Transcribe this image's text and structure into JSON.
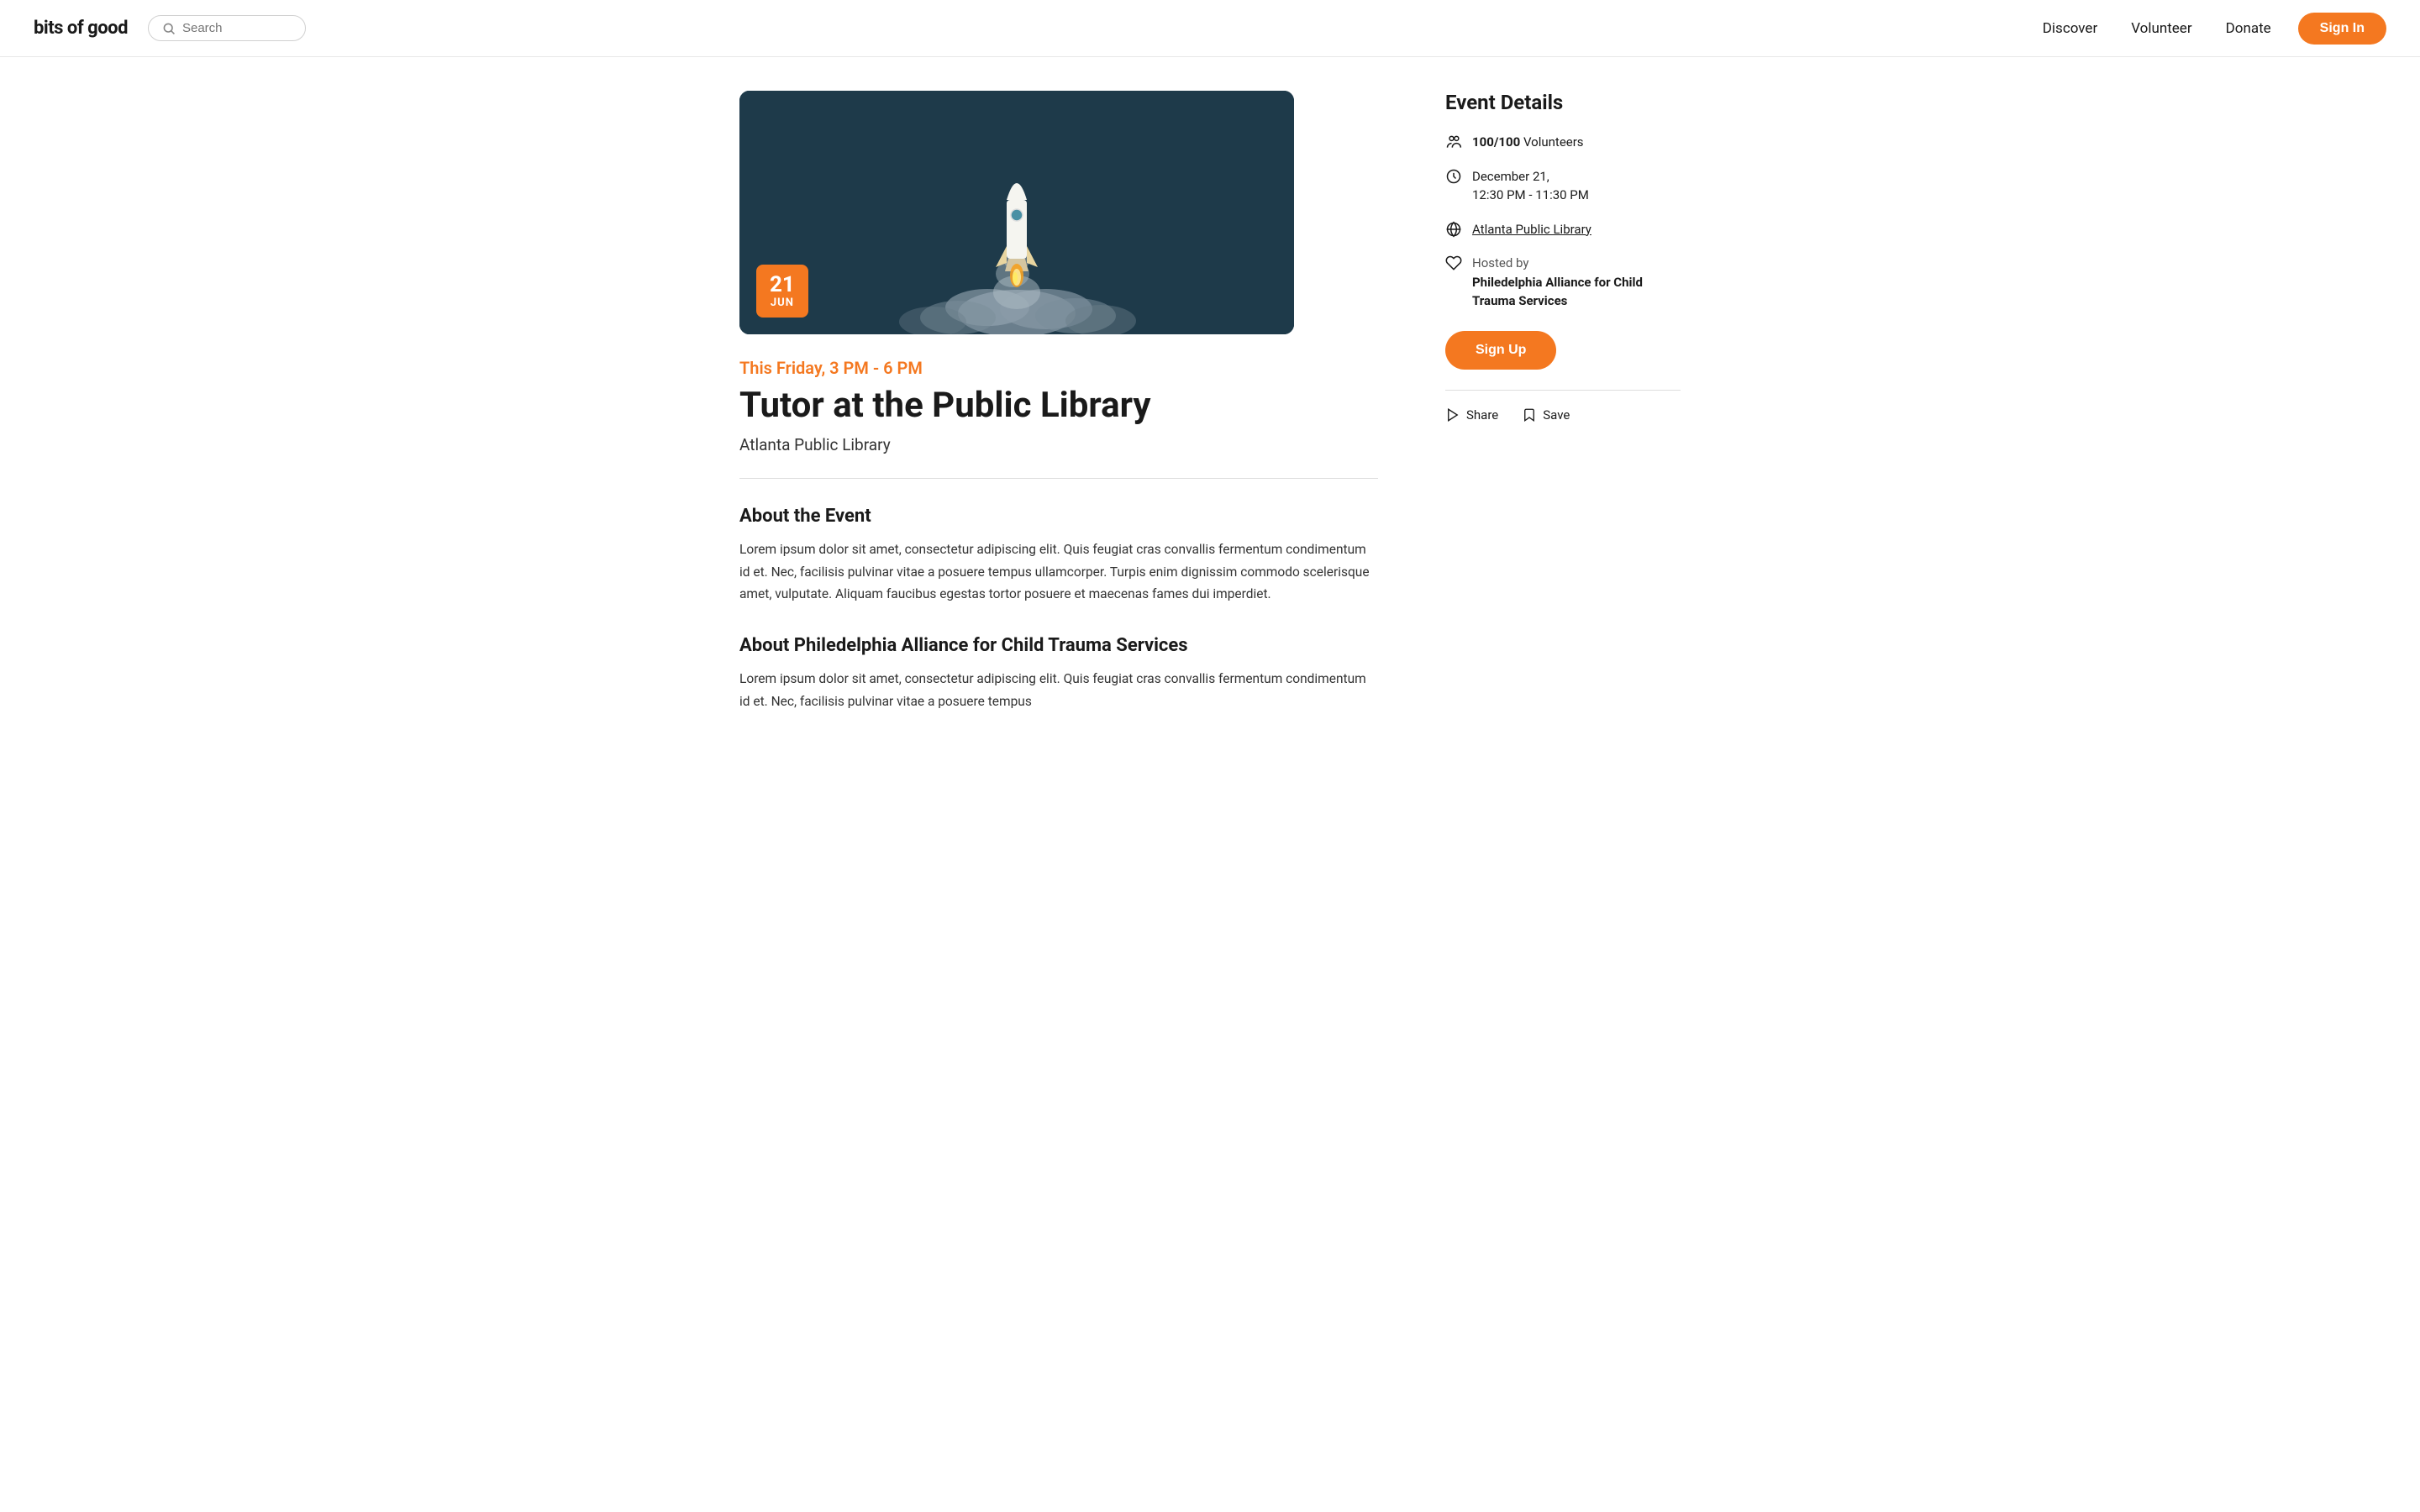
{
  "nav": {
    "logo": "bits of good",
    "search_placeholder": "Search",
    "links": [
      {
        "label": "Discover",
        "id": "discover"
      },
      {
        "label": "Volunteer",
        "id": "volunteer"
      },
      {
        "label": "Donate",
        "id": "donate"
      }
    ],
    "signin_label": "Sign In"
  },
  "hero": {
    "date_day": "21",
    "date_month": "JUN"
  },
  "event": {
    "time": "This Friday, 3 PM - 6 PM",
    "title": "Tutor at the Public Library",
    "location": "Atlanta Public Library",
    "about_heading": "About the Event",
    "about_text": "Lorem ipsum dolor sit amet, consectetur adipiscing elit. Quis feugiat cras convallis fermentum condimentum id et. Nec, facilisis pulvinar vitae a posuere tempus ullamcorper. Turpis enim dignissim commodo scelerisque amet, vulputate. Aliquam faucibus egestas tortor posuere et maecenas fames dui imperdiet.",
    "org_heading": "About Philedelphia Alliance for Child Trauma Services",
    "org_text": "Lorem ipsum dolor sit amet, consectetur adipiscing elit. Quis feugiat cras convallis fermentum condimentum id et. Nec, facilisis pulvinar vitae a posuere tempus"
  },
  "sidebar": {
    "title": "Event Details",
    "volunteers": "100/100",
    "volunteers_label": "Volunteers",
    "datetime": "December 21,",
    "datetime2": "12:30 PM - 11:30 PM",
    "venue": "Atlanta Public Library",
    "hosted_prefix": "Hosted by",
    "org_name": "Philedelphia Alliance for Child Trauma Services",
    "signup_label": "Sign Up",
    "share_label": "Share",
    "save_label": "Save"
  }
}
